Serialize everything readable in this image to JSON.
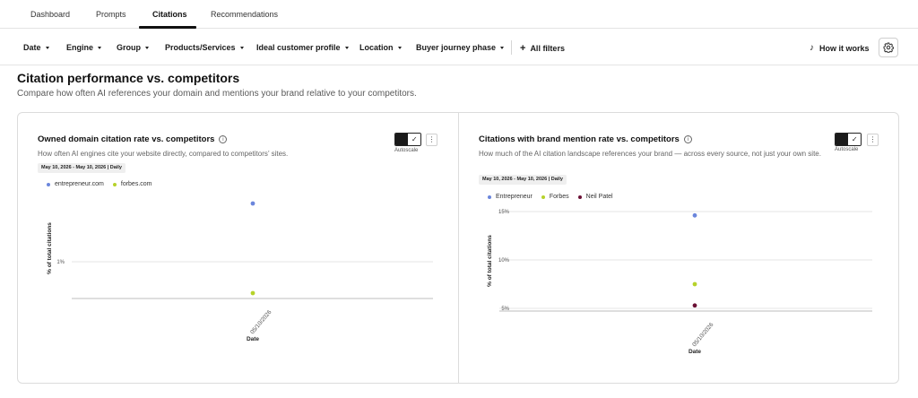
{
  "tabs": [
    {
      "label": "Dashboard"
    },
    {
      "label": "Prompts"
    },
    {
      "label": "Citations",
      "active": true
    },
    {
      "label": "Recommendations"
    }
  ],
  "filters": {
    "items": [
      "Date",
      "Engine",
      "Group",
      "Products/Services",
      "Ideal customer profile",
      "Location",
      "Buyer journey phase"
    ],
    "all_filters": "All filters",
    "how_it_works": "How it works",
    "icons": {
      "plus": "plus-icon",
      "how": "music-note-icon",
      "settings": "gear-icon",
      "caret": "caret-down-icon"
    }
  },
  "section": {
    "title": "Citation performance vs. competitors",
    "subtitle": "Compare how often AI references your domain and mentions your brand relative to your competitors."
  },
  "cards": [
    {
      "title": "Owned domain citation rate vs. competitors",
      "description": "How often AI engines cite your website directly, compared to competitors’ sites.",
      "date_range": "May 10, 2026 - May 10, 2026 | Daily",
      "autoscale_label": "Autoscale",
      "more_glyph": "⋮",
      "legend": [
        {
          "name": "entrepreneur.com",
          "color": "#6b86dc"
        },
        {
          "name": "forbes.com",
          "color": "#b6d22a"
        }
      ]
    },
    {
      "title": "Citations with brand mention rate vs. competitors",
      "description": "How much of the AI citation landscape references your brand — across every source, not just your own site.",
      "date_range": "May 10, 2026 - May 10, 2026 | Daily",
      "autoscale_label": "Autoscale",
      "more_glyph": "⋮",
      "legend": [
        {
          "name": "Entrepreneur",
          "color": "#6b86dc"
        },
        {
          "name": "Forbes",
          "color": "#b6d22a"
        },
        {
          "name": "Neil Patel",
          "color": "#6b1035"
        }
      ]
    }
  ],
  "chart_data": [
    {
      "type": "scatter",
      "xlabel": "Date",
      "ylabel": "% of total citations",
      "x": [
        "05/10/2026"
      ],
      "y_ticks": [
        "1%"
      ],
      "ylim": [
        0,
        1.5
      ],
      "grid": true,
      "legend": "top-left",
      "series": [
        {
          "name": "entrepreneur.com",
          "color": "#6b86dc",
          "values": [
            1.5
          ]
        },
        {
          "name": "forbes.com",
          "color": "#b6d22a",
          "values": [
            0.1
          ]
        }
      ]
    },
    {
      "type": "scatter",
      "xlabel": "Date",
      "ylabel": "% of total citations",
      "x": [
        "05/10/2026"
      ],
      "y_ticks": [
        "15%",
        "10%",
        "5%"
      ],
      "ylim": [
        5,
        15
      ],
      "grid": true,
      "legend": "top-left",
      "series": [
        {
          "name": "Entrepreneur",
          "color": "#6b86dc",
          "values": [
            14.6
          ]
        },
        {
          "name": "Forbes",
          "color": "#b6d22a",
          "values": [
            7.5
          ]
        },
        {
          "name": "Neil Patel",
          "color": "#6b1035",
          "values": [
            5.3
          ]
        }
      ]
    }
  ]
}
